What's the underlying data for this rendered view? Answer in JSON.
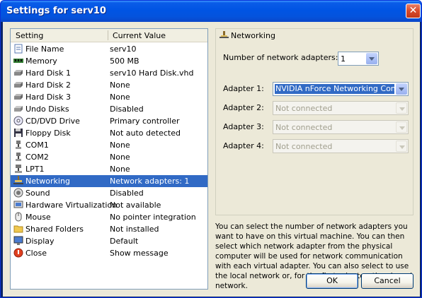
{
  "window": {
    "title": "Settings for serv10"
  },
  "list": {
    "col_setting": "Setting",
    "col_value": "Current Value",
    "selected_index": 11,
    "rows": [
      {
        "label": "File Name",
        "value": "serv10",
        "icon": "file-icon"
      },
      {
        "label": "Memory",
        "value": "500 MB",
        "icon": "memory-icon"
      },
      {
        "label": "Hard Disk 1",
        "value": "serv10 Hard Disk.vhd",
        "icon": "hard-disk-icon"
      },
      {
        "label": "Hard Disk 2",
        "value": "None",
        "icon": "hard-disk-icon"
      },
      {
        "label": "Hard Disk 3",
        "value": "None",
        "icon": "hard-disk-icon"
      },
      {
        "label": "Undo Disks",
        "value": "Disabled",
        "icon": "undo-disk-icon"
      },
      {
        "label": "CD/DVD Drive",
        "value": "Primary controller",
        "icon": "cd-icon"
      },
      {
        "label": "Floppy Disk",
        "value": "Not auto detected",
        "icon": "floppy-icon"
      },
      {
        "label": "COM1",
        "value": "None",
        "icon": "com-port-icon"
      },
      {
        "label": "COM2",
        "value": "None",
        "icon": "com-port-icon"
      },
      {
        "label": "LPT1",
        "value": "None",
        "icon": "lpt-port-icon"
      },
      {
        "label": "Networking",
        "value": "Network adapters: 1",
        "icon": "network-icon"
      },
      {
        "label": "Sound",
        "value": "Disabled",
        "icon": "sound-icon"
      },
      {
        "label": "Hardware Virtualization",
        "value": "Not available",
        "icon": "hardware-icon"
      },
      {
        "label": "Mouse",
        "value": "No pointer integration",
        "icon": "mouse-icon"
      },
      {
        "label": "Shared Folders",
        "value": "Not installed",
        "icon": "folder-icon"
      },
      {
        "label": "Display",
        "value": "Default",
        "icon": "display-icon"
      },
      {
        "label": "Close",
        "value": "Show message",
        "icon": "close-icon"
      }
    ]
  },
  "networking": {
    "group_title": "Networking",
    "num_adapters_label": "Number of network adapters:",
    "num_adapters_value": "1",
    "adapters": [
      {
        "label": "Adapter 1:",
        "value": "NVIDIA nForce Networking Controller",
        "enabled": true
      },
      {
        "label": "Adapter 2:",
        "value": "Not connected",
        "enabled": false
      },
      {
        "label": "Adapter 3:",
        "value": "Not connected",
        "enabled": false
      },
      {
        "label": "Adapter 4:",
        "value": "Not connected",
        "enabled": false
      }
    ],
    "description": "You can select the number of network adapters you want to have on this virtual machine. You can then select which network adapter from the physical computer will be used for network communication with each virtual adapter. You can also select to use the local network or, for the first adapter, the shared network."
  },
  "buttons": {
    "ok": "OK",
    "cancel": "Cancel"
  },
  "colors": {
    "title_bar": "#0054e3",
    "selection": "#316ac5",
    "dialog_bg": "#ece9d8"
  }
}
